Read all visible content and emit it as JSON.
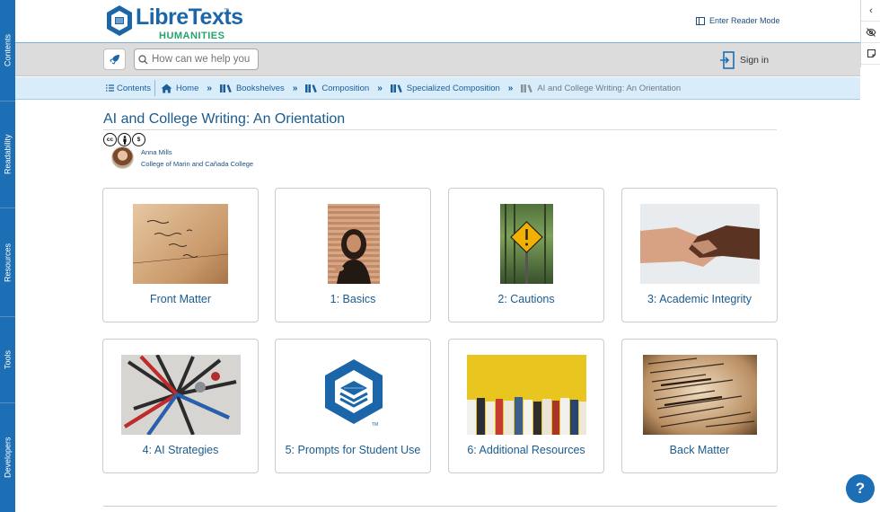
{
  "sidebar_left": {
    "tabs": [
      "Contents",
      "Readability",
      "Resources",
      "Tools",
      "Developers"
    ]
  },
  "right_bar": {
    "buttons": [
      "collapse-icon",
      "eye-off-icon",
      "note-icon"
    ]
  },
  "header": {
    "logo_text": "LibreTexts",
    "logo_tm": "™",
    "logo_sub": "HUMANITIES",
    "reader_mode_label": "Enter Reader Mode"
  },
  "toolbar": {
    "search_placeholder": "How can we help you?",
    "sign_in_label": "Sign in"
  },
  "breadcrumb": {
    "contents_label": "Contents",
    "items": [
      "Home",
      "Bookshelves",
      "Composition",
      "Specialized Composition",
      "AI and College Writing: An Orientation"
    ]
  },
  "page": {
    "title": "AI and College Writing: An Orientation",
    "license_icons": [
      "cc",
      "by",
      "nc"
    ],
    "author_name": "Anna Mills",
    "author_affiliation": "College of Marin and Cañada College"
  },
  "cards": [
    {
      "label": "Front Matter",
      "image": "handwritten-note-image"
    },
    {
      "label": "1: Basics",
      "image": "woman-portrait-image"
    },
    {
      "label": "2: Cautions",
      "image": "warning-sign-image"
    },
    {
      "label": "3: Academic Integrity",
      "image": "handshake-image"
    },
    {
      "label": "4: AI Strategies",
      "image": "tools-image"
    },
    {
      "label": "5: Prompts for Student Use",
      "image": "libretexts-logo-image"
    },
    {
      "label": "6: Additional Resources",
      "image": "books-image"
    },
    {
      "label": "Back Matter",
      "image": "dictionary-image"
    }
  ],
  "help_label": "?",
  "colors": {
    "brand_blue": "#1c6fb5",
    "logo_green": "#21a56a",
    "link_blue": "#1a5b8f",
    "breadcrumb_bg": "#d9ecfa"
  }
}
